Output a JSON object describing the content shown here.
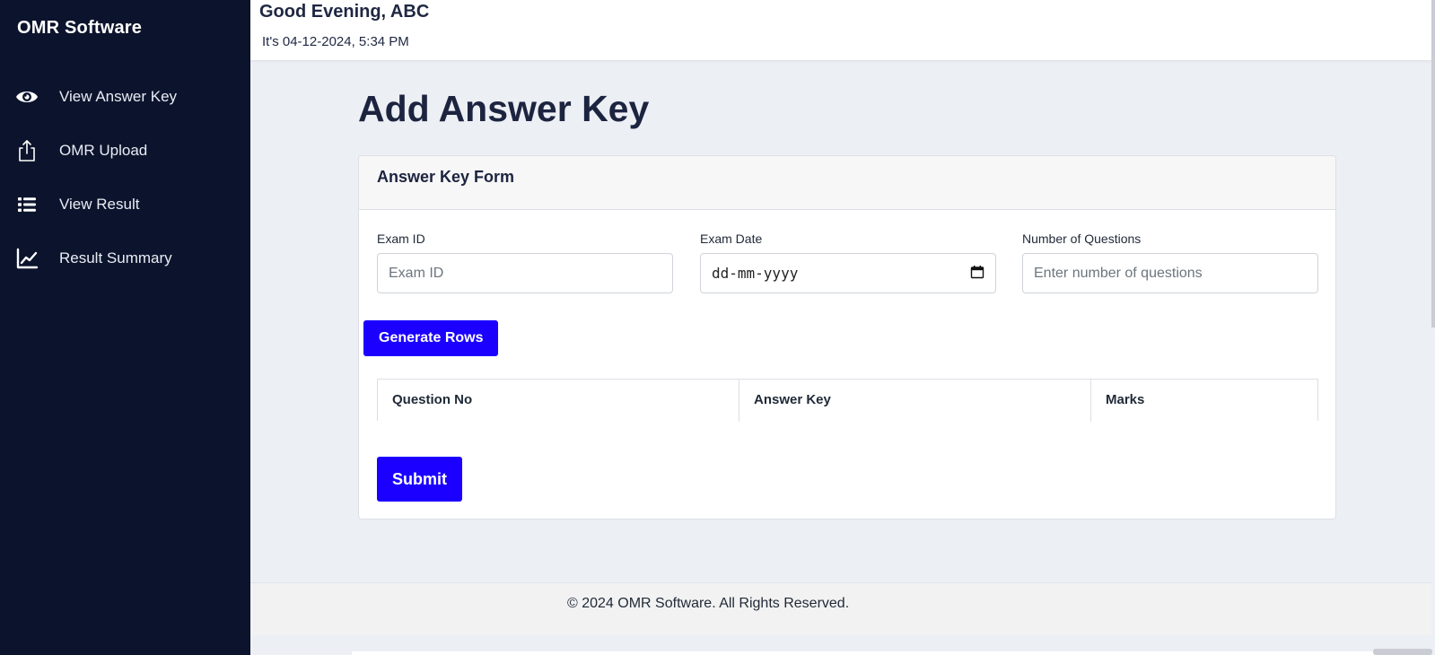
{
  "sidebar": {
    "brand": "OMR Software",
    "items": [
      {
        "label": "View Answer Key",
        "icon": "eye-icon"
      },
      {
        "label": "OMR Upload",
        "icon": "upload-icon"
      },
      {
        "label": "View Result",
        "icon": "list-icon"
      },
      {
        "label": "Result Summary",
        "icon": "chart-line-icon"
      }
    ]
  },
  "header": {
    "greeting": "Good Evening, ABC",
    "datetime": "It's 04-12-2024, 5:34 PM"
  },
  "main": {
    "title": "Add Answer Key",
    "form": {
      "title": "Answer Key Form",
      "exam_id": {
        "label": "Exam ID",
        "placeholder": "Exam ID"
      },
      "exam_date": {
        "label": "Exam Date",
        "placeholder": "dd-mm-yyyy"
      },
      "num_questions": {
        "label": "Number of Questions",
        "placeholder": "Enter number of questions"
      },
      "generate_label": "Generate Rows",
      "table_headers": [
        "Question No",
        "Answer Key",
        "Marks"
      ],
      "submit_label": "Submit"
    }
  },
  "footer": {
    "text": "© 2024 OMR Software. All Rights Reserved."
  },
  "colors": {
    "sidebar_bg": "#0c142d",
    "accent": "#1b00ff",
    "page_bg": "#eceff4"
  }
}
